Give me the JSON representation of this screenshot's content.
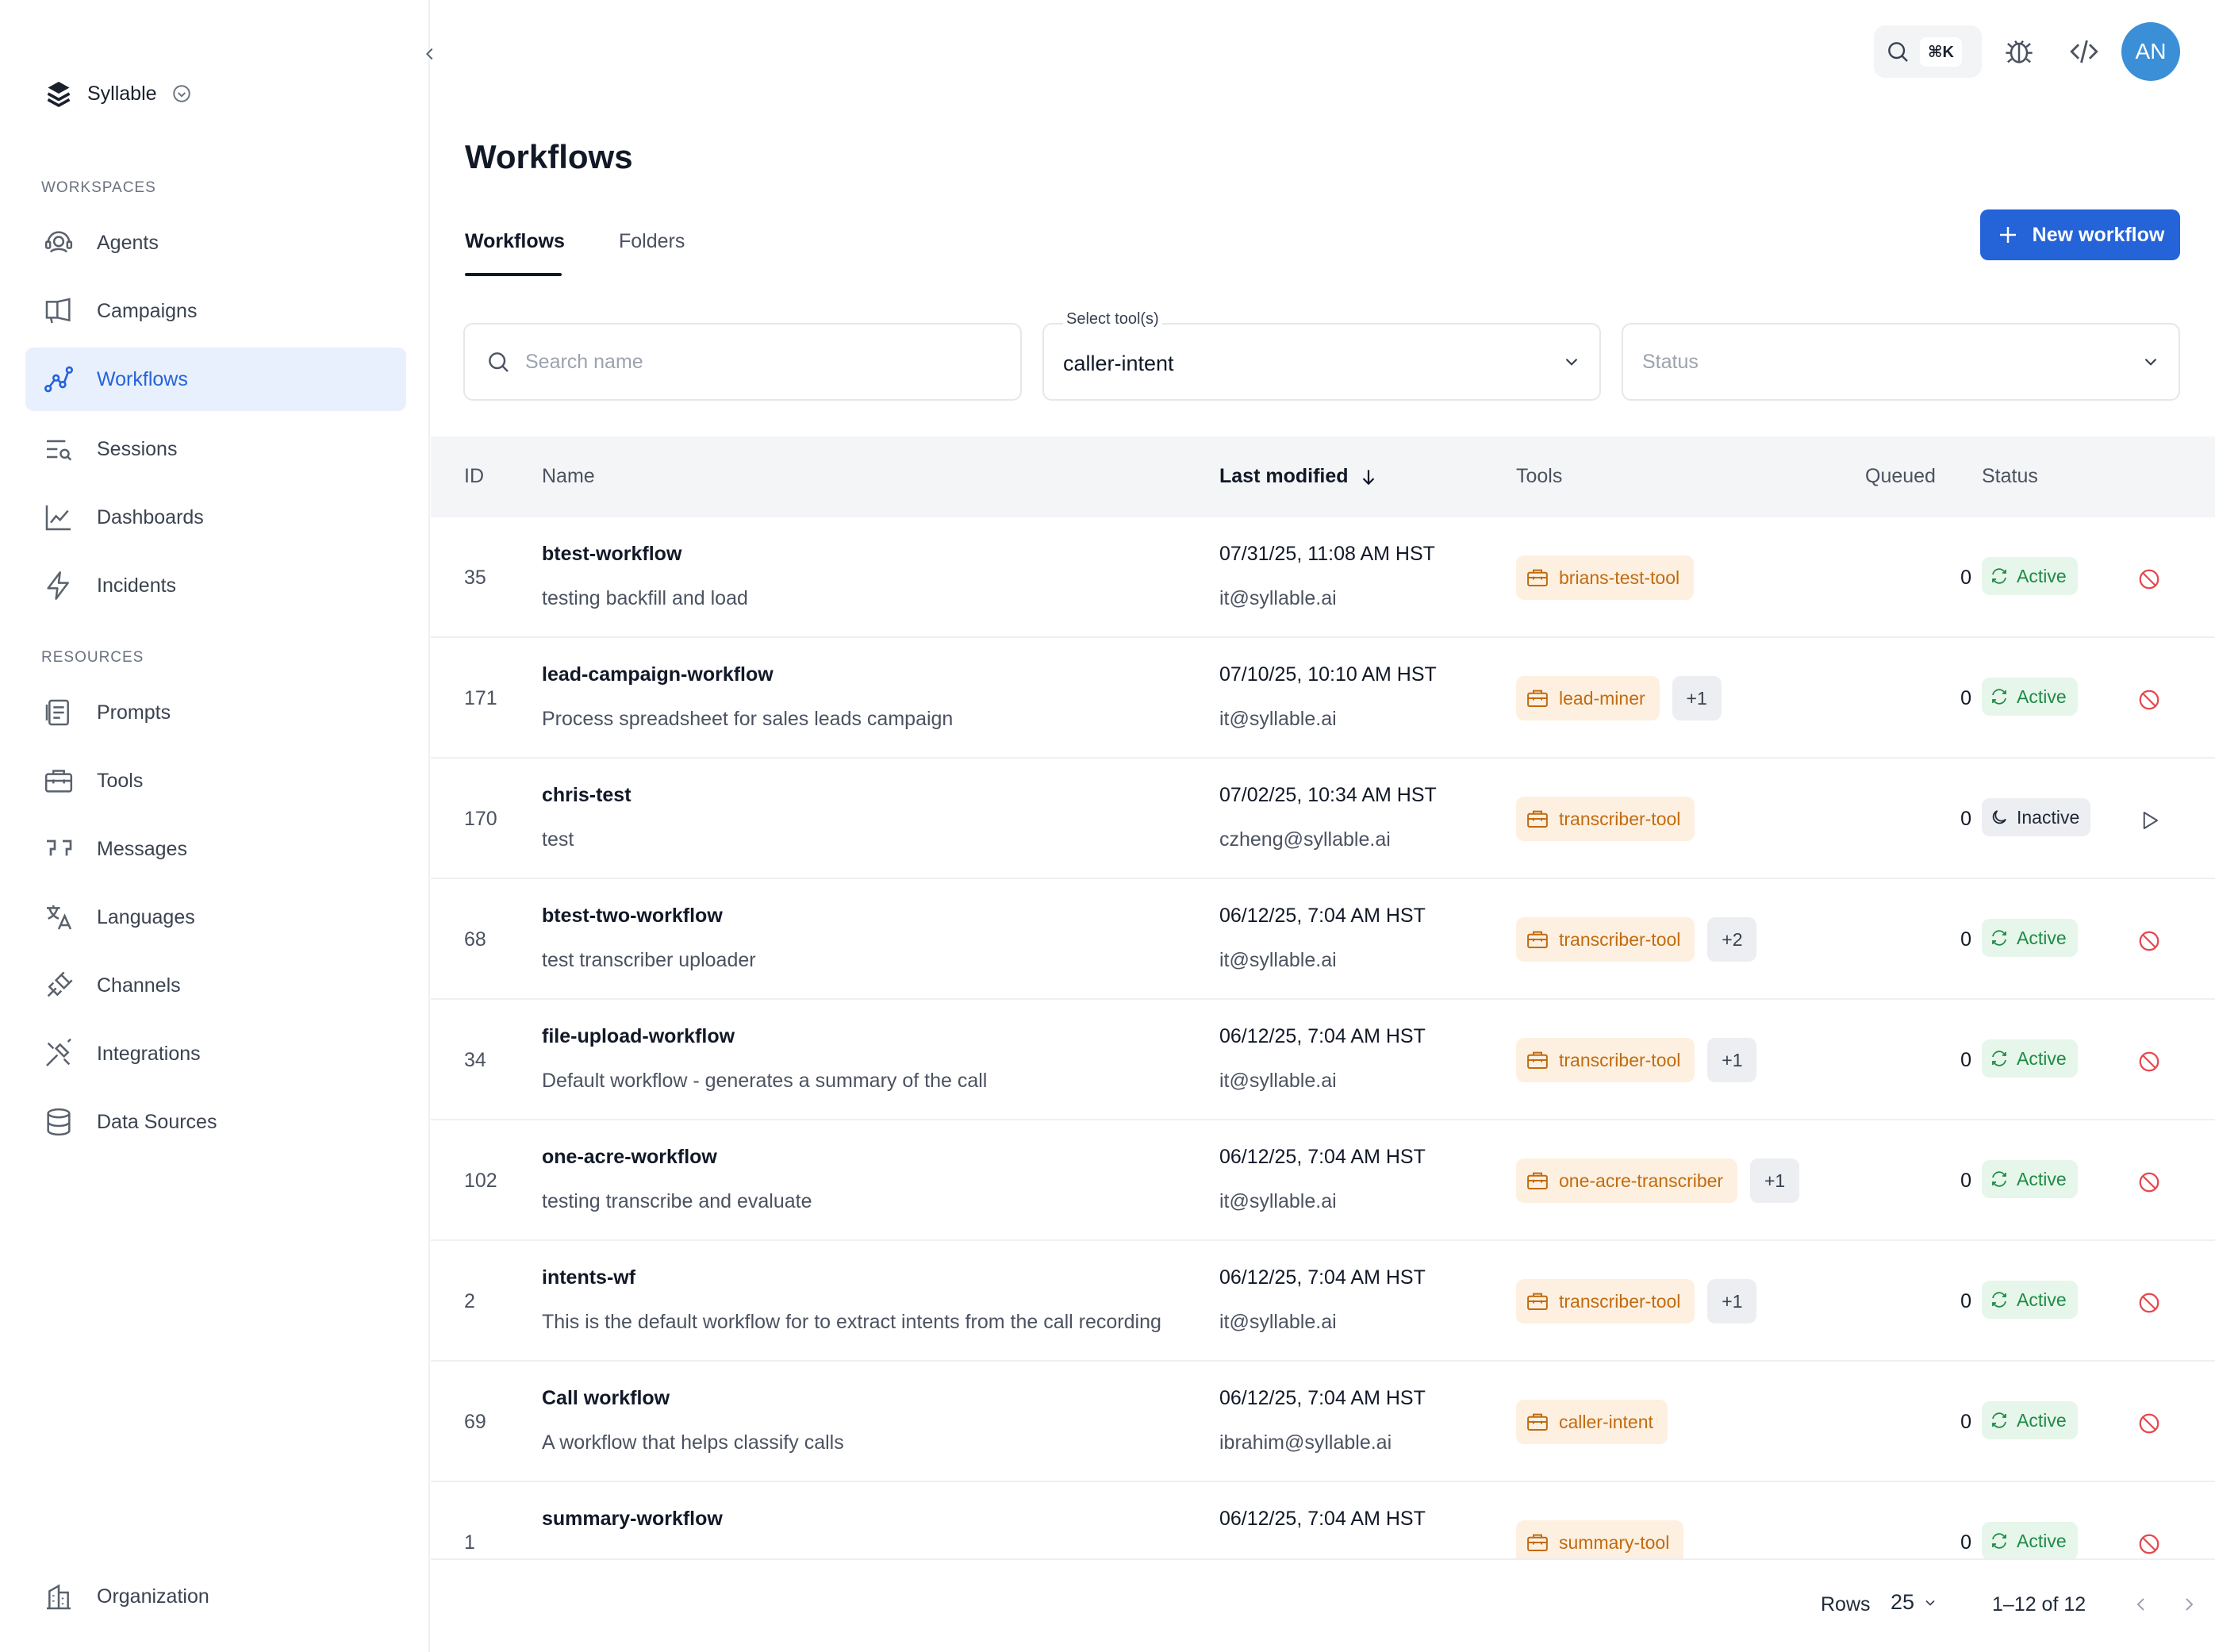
{
  "workspace": {
    "name": "Syllable"
  },
  "sidebar": {
    "sections": {
      "workspaces": "WORKSPACES",
      "resources": "RESOURCES"
    },
    "items": [
      {
        "label": "Agents"
      },
      {
        "label": "Campaigns"
      },
      {
        "label": "Workflows",
        "active": true
      },
      {
        "label": "Sessions"
      },
      {
        "label": "Dashboards"
      },
      {
        "label": "Incidents"
      },
      {
        "label": "Prompts"
      },
      {
        "label": "Tools"
      },
      {
        "label": "Messages"
      },
      {
        "label": "Languages"
      },
      {
        "label": "Channels"
      },
      {
        "label": "Integrations"
      },
      {
        "label": "Data Sources"
      }
    ],
    "footer_item": {
      "label": "Organization"
    }
  },
  "topbar": {
    "shortcut": "⌘K",
    "avatar_initials": "AN"
  },
  "page": {
    "title": "Workflows",
    "tabs": [
      {
        "label": "Workflows",
        "active": true
      },
      {
        "label": "Folders"
      }
    ],
    "new_button": "New workflow"
  },
  "filters": {
    "search_placeholder": "Search name",
    "tools_label": "Select tool(s)",
    "tools_value": "caller-intent",
    "status_placeholder": "Status"
  },
  "table": {
    "columns": {
      "id": "ID",
      "name": "Name",
      "last_modified": "Last modified",
      "tools": "Tools",
      "queued": "Queued",
      "status": "Status"
    },
    "sort": {
      "column": "last_modified",
      "direction": "desc"
    },
    "rows": [
      {
        "id": "35",
        "name": "btest-workflow",
        "description": "testing backfill and load",
        "modified": "07/31/25, 11:08 AM HST",
        "author": "it@syllable.ai",
        "tool": "brians-test-tool",
        "extra": "",
        "queued": "0",
        "status": "Active"
      },
      {
        "id": "171",
        "name": "lead-campaign-workflow",
        "description": "Process spreadsheet for sales leads campaign",
        "modified": "07/10/25, 10:10 AM HST",
        "author": "it@syllable.ai",
        "tool": "lead-miner",
        "extra": "+1",
        "queued": "0",
        "status": "Active"
      },
      {
        "id": "170",
        "name": "chris-test",
        "description": "test",
        "modified": "07/02/25, 10:34 AM HST",
        "author": "czheng@syllable.ai",
        "tool": "transcriber-tool",
        "extra": "",
        "queued": "0",
        "status": "Inactive"
      },
      {
        "id": "68",
        "name": "btest-two-workflow",
        "description": "test transcriber uploader",
        "modified": "06/12/25, 7:04 AM HST",
        "author": "it@syllable.ai",
        "tool": "transcriber-tool",
        "extra": "+2",
        "queued": "0",
        "status": "Active"
      },
      {
        "id": "34",
        "name": "file-upload-workflow",
        "description": "Default workflow - generates a summary of the call",
        "modified": "06/12/25, 7:04 AM HST",
        "author": "it@syllable.ai",
        "tool": "transcriber-tool",
        "extra": "+1",
        "queued": "0",
        "status": "Active"
      },
      {
        "id": "102",
        "name": "one-acre-workflow",
        "description": "testing transcribe and evaluate",
        "modified": "06/12/25, 7:04 AM HST",
        "author": "it@syllable.ai",
        "tool": "one-acre-transcriber",
        "extra": "+1",
        "queued": "0",
        "status": "Active"
      },
      {
        "id": "2",
        "name": "intents-wf",
        "description": "This is the default workflow for to extract intents from the call recording",
        "modified": "06/12/25, 7:04 AM HST",
        "author": "it@syllable.ai",
        "tool": "transcriber-tool",
        "extra": "+1",
        "queued": "0",
        "status": "Active"
      },
      {
        "id": "69",
        "name": "Call workflow",
        "description": "A workflow that helps classify calls",
        "modified": "06/12/25, 7:04 AM HST",
        "author": "ibrahim@syllable.ai",
        "tool": "caller-intent",
        "extra": "",
        "queued": "0",
        "status": "Active"
      },
      {
        "id": "1",
        "name": "summary-workflow",
        "description": "",
        "modified": "06/12/25, 7:04 AM HST",
        "author": "",
        "tool": "summary-tool",
        "extra": "",
        "queued": "0",
        "status": "Active"
      }
    ]
  },
  "pagination": {
    "rows_label": "Rows",
    "rows_per_page": "25",
    "range": "1–12 of 12"
  },
  "colors": {
    "accent": "#2563d9",
    "tool_chip": "#fdf0e0",
    "active": "#1f8a46",
    "danger": "#e5484d"
  }
}
